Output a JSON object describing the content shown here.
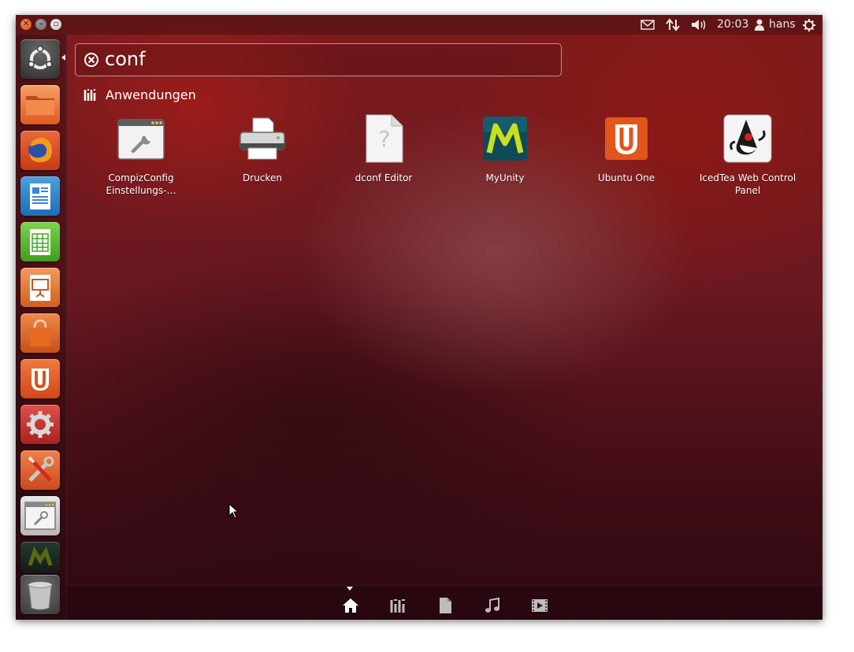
{
  "window_controls": [
    "close",
    "minimize",
    "maximize"
  ],
  "top_panel": {
    "indicators": [
      "mail-icon",
      "network-icon",
      "volume-icon"
    ],
    "clock": "20:03",
    "user": "hans",
    "session_icon": "power-gear-icon"
  },
  "launcher": {
    "items": [
      {
        "name": "dash-home",
        "icon": "ubuntu-logo-icon"
      },
      {
        "name": "files",
        "icon": "folder-icon"
      },
      {
        "name": "firefox",
        "icon": "firefox-icon"
      },
      {
        "name": "libreoffice-writer",
        "icon": "writer-icon"
      },
      {
        "name": "libreoffice-calc",
        "icon": "calc-icon"
      },
      {
        "name": "libreoffice-impress",
        "icon": "impress-icon"
      },
      {
        "name": "software-center",
        "icon": "shopping-bag-icon"
      },
      {
        "name": "ubuntu-one",
        "icon": "ubuntu-one-icon"
      },
      {
        "name": "system-settings",
        "icon": "settings-gear-icon"
      },
      {
        "name": "tools",
        "icon": "tools-icon"
      },
      {
        "name": "compizconfig",
        "icon": "window-wrench-icon"
      },
      {
        "name": "myunity",
        "icon": "myunity-icon"
      },
      {
        "name": "trash",
        "icon": "trash-icon"
      }
    ]
  },
  "search": {
    "value": "conf",
    "clear_icon": "clear-circle-icon"
  },
  "category": {
    "label": "Anwendungen",
    "icon": "applications-lens-icon"
  },
  "apps": [
    {
      "label": "CompizConfig Einstellungs-…",
      "icon": "compizconfig-icon"
    },
    {
      "label": "Drucken",
      "icon": "printer-icon"
    },
    {
      "label": "dconf Editor",
      "icon": "unknown-file-icon"
    },
    {
      "label": "MyUnity",
      "icon": "myunity-icon"
    },
    {
      "label": "Ubuntu One",
      "icon": "ubuntu-one-icon"
    },
    {
      "label": "IcedTea Web Control Panel",
      "icon": "java-duke-icon"
    }
  ],
  "lenses": [
    "home-lens-icon",
    "applications-lens-icon",
    "files-lens-icon",
    "music-lens-icon",
    "video-lens-icon"
  ],
  "colors": {
    "accent_orange": "#dd4814",
    "background_red": "#7e1b1d",
    "text": "#ffffff"
  }
}
